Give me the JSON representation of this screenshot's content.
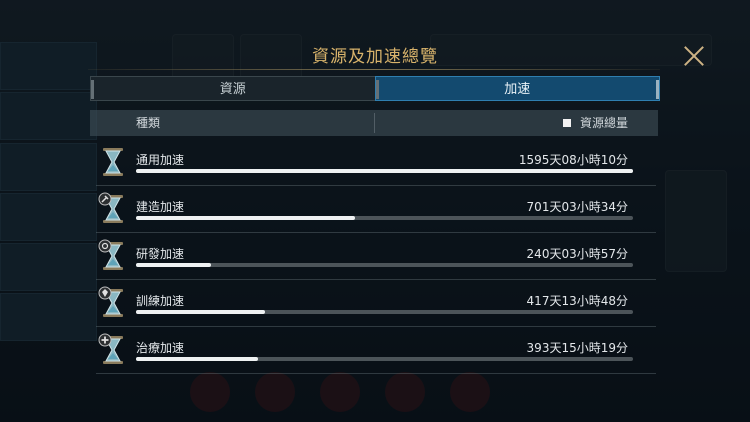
{
  "dialog": {
    "title": "資源及加速總覽"
  },
  "tabs": [
    {
      "label": "資源",
      "active": false
    },
    {
      "label": "加速",
      "active": true
    }
  ],
  "table_header": {
    "type_label": "種類",
    "legend_label": "資源總量"
  },
  "speedups": [
    {
      "name": "通用加速",
      "total": "1595天08小時10分",
      "bar_fraction": 1.0,
      "icon": "hourglass-generic-icon"
    },
    {
      "name": "建造加速",
      "total": "701天03小時34分",
      "bar_fraction": 0.44,
      "icon": "hourglass-build-icon"
    },
    {
      "name": "研發加速",
      "total": "240天03小時57分",
      "bar_fraction": 0.15,
      "icon": "hourglass-research-icon"
    },
    {
      "name": "訓練加速",
      "total": "417天13小時48分",
      "bar_fraction": 0.26,
      "icon": "hourglass-training-icon"
    },
    {
      "name": "治療加速",
      "total": "393天15小時19分",
      "bar_fraction": 0.245,
      "icon": "hourglass-healing-icon"
    }
  ],
  "colors": {
    "title": "#d8b36b",
    "active_tab": "#134a6f",
    "bar_fill": "#eef1f2",
    "bar_track": "#4c5459"
  }
}
